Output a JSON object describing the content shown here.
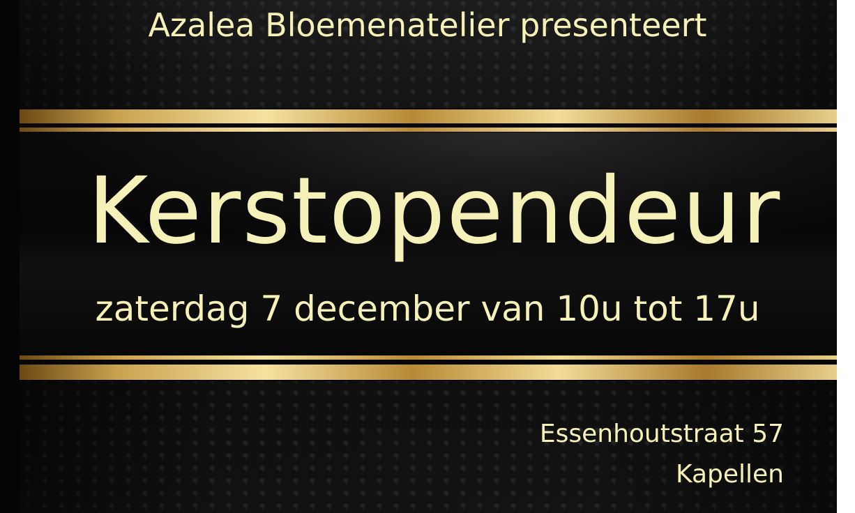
{
  "header": {
    "presenter": "Azalea Bloemenatelier presenteert"
  },
  "event": {
    "title": "Kerstopendeur",
    "date_line": "zaterdag 7 december van 10u tot 17u"
  },
  "address": {
    "street": "Essenhoutstraat 57",
    "city": "Kapellen"
  },
  "colors": {
    "text": "#f5f1b9",
    "gold": "#d8b66a",
    "background": "#141414"
  }
}
